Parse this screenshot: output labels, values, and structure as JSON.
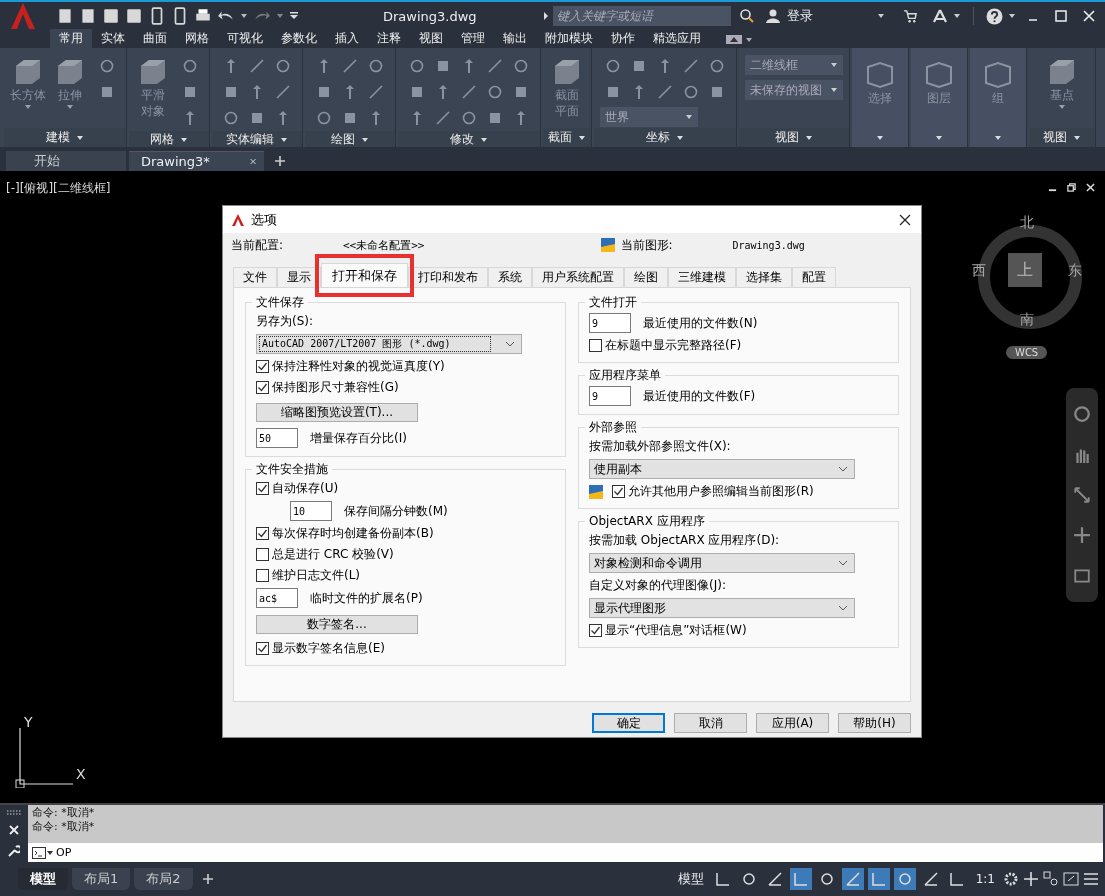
{
  "app": {
    "title": "Drawing3.dwg",
    "search": {
      "placeholder": "键入关键字或短语"
    },
    "sign_in": "登录"
  },
  "ribbon_tabs": [
    {
      "label": "常用",
      "selected": true
    },
    {
      "label": "实体",
      "selected": false
    },
    {
      "label": "曲面",
      "selected": false
    },
    {
      "label": "网格",
      "selected": false
    },
    {
      "label": "可视化",
      "selected": false
    },
    {
      "label": "参数化",
      "selected": false
    },
    {
      "label": "插入",
      "selected": false
    },
    {
      "label": "注释",
      "selected": false
    },
    {
      "label": "视图",
      "selected": false
    },
    {
      "label": "管理",
      "selected": false
    },
    {
      "label": "输出",
      "selected": false
    },
    {
      "label": "附加模块",
      "selected": false
    },
    {
      "label": "协作",
      "selected": false
    },
    {
      "label": "精选应用",
      "selected": false
    }
  ],
  "ribbon_panels": [
    {
      "title": "建模",
      "kind": "modeling",
      "buttons": [
        "长方体",
        "拉伸"
      ]
    },
    {
      "title": "网格",
      "kind": "mesh",
      "buttons": [
        "平滑对象"
      ]
    },
    {
      "title": "实体编辑",
      "kind": "solid_edit"
    },
    {
      "title": "绘图",
      "kind": "draw"
    },
    {
      "title": "修改",
      "kind": "modify"
    },
    {
      "title": "截面",
      "kind": "section",
      "buttons": [
        "截面平面"
      ]
    },
    {
      "title": "坐标",
      "kind": "coordinates",
      "dropdowns": [
        "世界"
      ]
    },
    {
      "title": "视图",
      "kind": "view",
      "dropdowns": [
        "二维线框",
        "未保存的视图"
      ]
    },
    {
      "kind": "collapsed",
      "buttons": [
        "选择"
      ]
    },
    {
      "kind": "collapsed",
      "buttons": [
        "图层"
      ]
    },
    {
      "kind": "collapsed",
      "buttons": [
        "组"
      ]
    },
    {
      "title": "视图",
      "kind": "base",
      "buttons": [
        "基点"
      ]
    }
  ],
  "doc_tabs": [
    {
      "label": "开始",
      "selected": false,
      "closable": false
    },
    {
      "label": "Drawing3*",
      "selected": true,
      "closable": true
    }
  ],
  "viewport": {
    "label": "[-][俯视][二维线框]",
    "viewcube": {
      "north": "北",
      "south": "南",
      "east": "东",
      "west": "西",
      "face": "上",
      "ucs": "WCS"
    },
    "ucs_x": "X",
    "ucs_y": "Y"
  },
  "dialog": {
    "title": "选项",
    "current_profile_label": "当前配置:",
    "current_profile": "<<未命名配置>>",
    "current_drawing_label": "当前图形:",
    "current_drawing": "Drawing3.dwg",
    "tabs": [
      {
        "label": "文件",
        "selected": false,
        "highlighted": false
      },
      {
        "label": "显示",
        "selected": false,
        "highlighted": false
      },
      {
        "label": "打开和保存",
        "selected": true,
        "highlighted": true
      },
      {
        "label": "打印和发布",
        "selected": false,
        "highlighted": false
      },
      {
        "label": "系统",
        "selected": false,
        "highlighted": false
      },
      {
        "label": "用户系统配置",
        "selected": false,
        "highlighted": false
      },
      {
        "label": "绘图",
        "selected": false,
        "highlighted": false
      },
      {
        "label": "三维建模",
        "selected": false,
        "highlighted": false
      },
      {
        "label": "选择集",
        "selected": false,
        "highlighted": false
      },
      {
        "label": "配置",
        "selected": false,
        "highlighted": false
      }
    ],
    "left_groups": [
      {
        "title": "文件保存",
        "items": [
          {
            "kind": "label",
            "text": "另存为(S):"
          },
          {
            "kind": "select",
            "value": "AutoCAD 2007/LT2007 图形 (*.dwg)",
            "focused": true
          },
          {
            "kind": "checkbox",
            "text": "保持注释性对象的视觉逼真度(Y)",
            "checked": true
          },
          {
            "kind": "checkbox",
            "text": "保持图形尺寸兼容性(G)",
            "checked": true
          },
          {
            "kind": "button",
            "text": "缩略图预览设置(T)..."
          },
          {
            "kind": "input",
            "value": "50",
            "text": "增量保存百分比(I)",
            "indent": false
          }
        ]
      },
      {
        "title": "文件安全措施",
        "items": [
          {
            "kind": "checkbox",
            "text": "自动保存(U)",
            "checked": true
          },
          {
            "kind": "input",
            "value": "10",
            "text": "保存间隔分钟数(M)",
            "indent": true
          },
          {
            "kind": "checkbox",
            "text": "每次保存时均创建备份副本(B)",
            "checked": true
          },
          {
            "kind": "checkbox",
            "text": "总是进行 CRC 校验(V)",
            "checked": false
          },
          {
            "kind": "checkbox",
            "text": "维护日志文件(L)",
            "checked": false
          },
          {
            "kind": "input",
            "value": "ac$",
            "text": "临时文件的扩展名(P)",
            "indent": false
          },
          {
            "kind": "button",
            "text": "数字签名..."
          },
          {
            "kind": "checkbox",
            "text": "显示数字签名信息(E)",
            "checked": true
          }
        ]
      }
    ],
    "right_groups": [
      {
        "title": "文件打开",
        "items": [
          {
            "kind": "input",
            "value": "9",
            "text": "最近使用的文件数(N)",
            "indent": false
          },
          {
            "kind": "checkbox",
            "text": "在标题中显示完整路径(F)",
            "checked": false
          }
        ]
      },
      {
        "title": "应用程序菜单",
        "items": [
          {
            "kind": "input",
            "value": "9",
            "text": "最近使用的文件数(F)",
            "indent": false
          }
        ]
      },
      {
        "title": "外部参照",
        "items": [
          {
            "kind": "label",
            "text": "按需加载外部参照文件(X):"
          },
          {
            "kind": "select",
            "value": "使用副本",
            "focused": false
          },
          {
            "kind": "icon_checkbox",
            "text": "允许其他用户参照编辑当前图形(R)",
            "checked": true
          }
        ]
      },
      {
        "title": "ObjectARX 应用程序",
        "items": [
          {
            "kind": "label",
            "text": "按需加载 ObjectARX 应用程序(D):"
          },
          {
            "kind": "select",
            "value": "对象检测和命令调用",
            "focused": false
          },
          {
            "kind": "label",
            "text": "自定义对象的代理图像(J):"
          },
          {
            "kind": "select",
            "value": "显示代理图形",
            "focused": false
          },
          {
            "kind": "checkbox",
            "text": "显示“代理信息”对话框(W)",
            "checked": true
          }
        ]
      }
    ],
    "buttons": [
      {
        "label": "确定",
        "default": true
      },
      {
        "label": "取消",
        "default": false
      },
      {
        "label": "应用(A)",
        "default": false
      },
      {
        "label": "帮助(H)",
        "default": false
      }
    ]
  },
  "command": {
    "history": [
      "命令: *取消*",
      "命令: *取消*"
    ],
    "input": "OP"
  },
  "layout_tabs": [
    {
      "label": "模型",
      "selected": true
    },
    {
      "label": "布局1",
      "selected": false
    },
    {
      "label": "布局2",
      "selected": false
    }
  ],
  "status_bar": {
    "model_button": "模型",
    "toggles": [
      {
        "on": false
      },
      {
        "on": false
      },
      {
        "on": false
      },
      {
        "on": true
      },
      {
        "on": false
      },
      {
        "on": true
      },
      {
        "on": true
      },
      {
        "on": true
      },
      {
        "on": false
      },
      {
        "on": false
      }
    ],
    "scale": "1:1"
  }
}
